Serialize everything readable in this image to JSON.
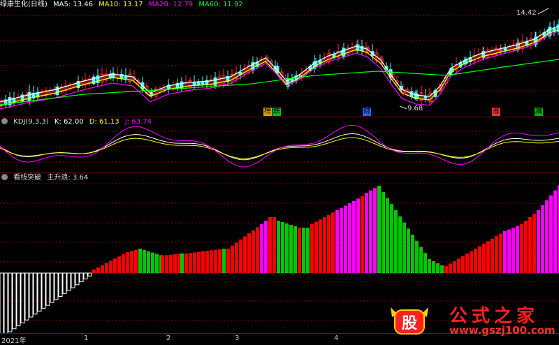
{
  "price": {
    "title": "绿康生化(日线)",
    "ma5": "MA5: 13.46",
    "ma10": "MA10: 13.17",
    "ma20": "MA20: 12.79",
    "ma60": "MA60: 11.92",
    "high_label": "14.42",
    "low_label": "9.68",
    "markers": [
      "榜",
      "跌",
      "财",
      "涨",
      "减"
    ],
    "colors": {
      "up": "#ff3232",
      "down": "#54ffff",
      "ma5": "#ffffff",
      "ma10": "#ffff00",
      "ma20": "#ff00ff",
      "ma60": "#00ff00"
    }
  },
  "kdj": {
    "title": "KDJ(9,3,3)",
    "k": "K: 62.00",
    "d": "D: 61.13",
    "j": "J: 63.74"
  },
  "main": {
    "title": "看线突破",
    "value": "主升浪: 3.64",
    "colors": {
      "red": "#ff0000",
      "green": "#00c800",
      "magenta": "#ff00ff",
      "white": "#ffffff"
    }
  },
  "axis": {
    "labels": [
      "2021年",
      "1",
      "2",
      "3",
      "4"
    ]
  },
  "watermark": {
    "glyph": "股",
    "text": "公式之家",
    "url": "www.gszj100.com"
  }
}
